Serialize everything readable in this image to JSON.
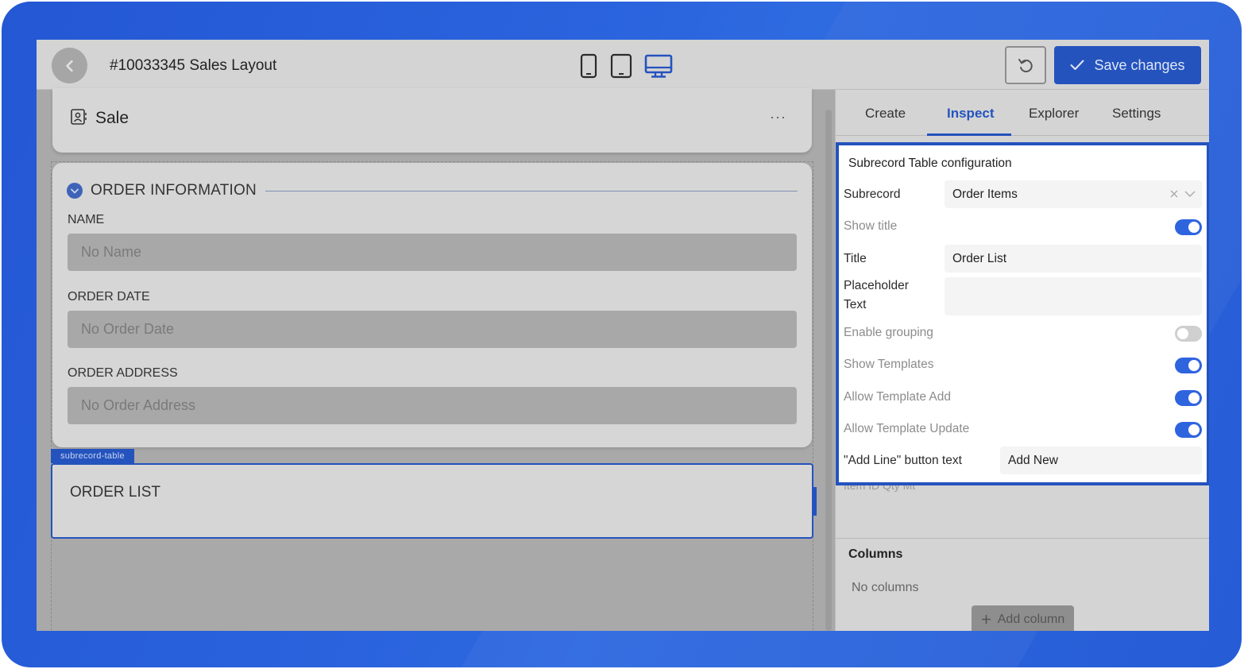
{
  "header": {
    "title": "#10033345  Sales Layout",
    "save_label": "Save changes",
    "icons": {
      "back": "chevron-left-icon",
      "phone": "phone-icon",
      "tablet": "tablet-icon",
      "desktop": "desktop-icon",
      "undo": "undo-icon",
      "save": "check-icon"
    },
    "active_device": "desktop"
  },
  "canvas": {
    "sale_title": "Sale",
    "sale_menu": "···",
    "section_title": "ORDER INFORMATION",
    "fields": [
      {
        "label": "NAME",
        "placeholder": "No Name"
      },
      {
        "label": "ORDER DATE",
        "placeholder": "No Order Date"
      },
      {
        "label": "ORDER ADDRESS",
        "placeholder": "No Order Address"
      }
    ],
    "chip_label": "subrecord-table",
    "list_title": "ORDER LIST"
  },
  "panel": {
    "tabs": [
      {
        "label": "Create"
      },
      {
        "label": "Inspect"
      },
      {
        "label": "Explorer"
      },
      {
        "label": "Settings"
      }
    ],
    "active_tab": "Inspect",
    "config_title": "Subrecord Table configuration",
    "subrecord_label": "Subrecord",
    "subrecord_value": "Order Items",
    "show_title_label": "Show title",
    "show_title": true,
    "title_label": "Title",
    "title_value": "Order List",
    "placeholder_label_1": "Placeholder",
    "placeholder_label_2": "Text",
    "placeholder_value": "",
    "enable_grouping_label": "Enable grouping",
    "enable_grouping": false,
    "show_templates_label": "Show Templates",
    "show_templates": true,
    "allow_template_add_label": "Allow Template Add",
    "allow_template_add": true,
    "allow_template_update_label": "Allow Template Update",
    "allow_template_update": true,
    "add_line_label": "\"Add Line\" button text",
    "add_line_value": "Add New",
    "ghost_row": "Item ID       Qty  Mt",
    "columns_title": "Columns",
    "no_columns": "No columns",
    "add_column_label": "Add column"
  },
  "colors": {
    "accent": "#2453be",
    "frame": "#2a63dd",
    "toggle_on": "#2f64df"
  }
}
